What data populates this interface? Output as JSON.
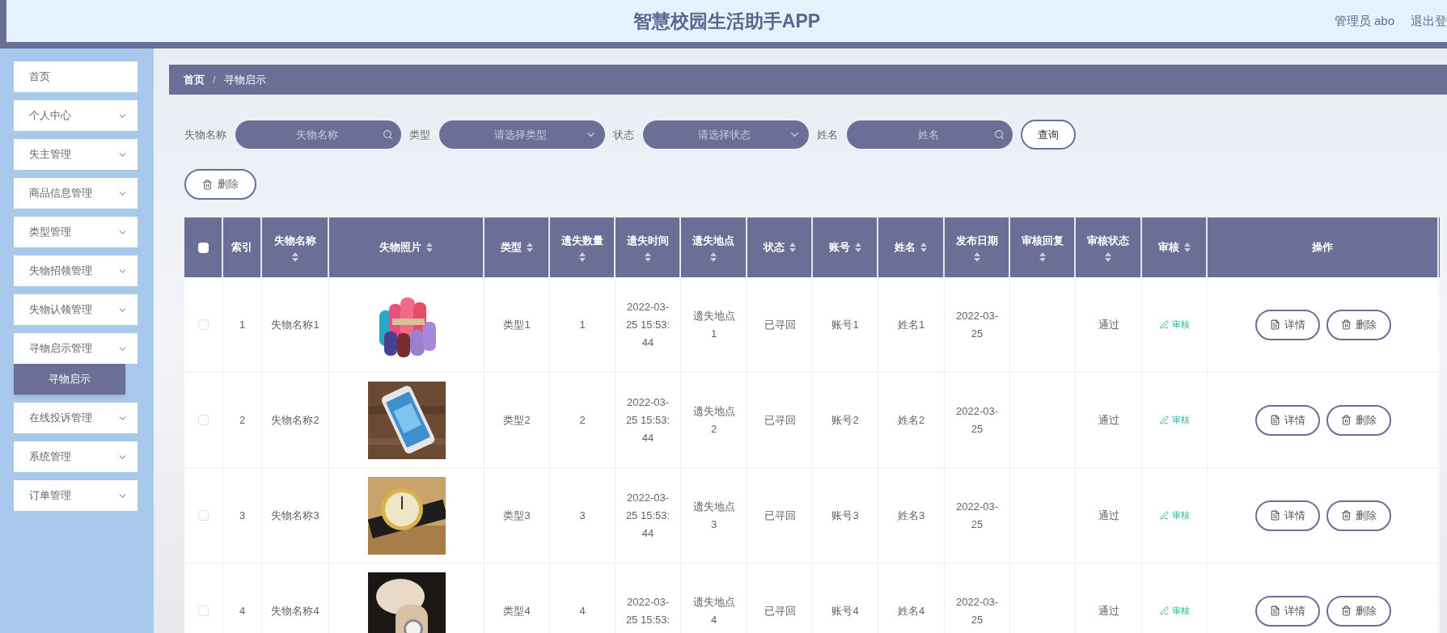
{
  "header": {
    "title": "智慧校园生活助手APP",
    "user": "管理员 abo",
    "logout": "退出登"
  },
  "sidebar": {
    "items": [
      {
        "label": "首页",
        "kind": "link"
      },
      {
        "label": "个人中心",
        "kind": "menu"
      },
      {
        "label": "失主管理",
        "kind": "menu"
      },
      {
        "label": "商品信息管理",
        "kind": "menu"
      },
      {
        "label": "类型管理",
        "kind": "menu"
      },
      {
        "label": "失物招领管理",
        "kind": "menu"
      },
      {
        "label": "失物认领管理",
        "kind": "menu"
      },
      {
        "label": "寻物启示管理",
        "kind": "menu",
        "children": [
          {
            "label": "寻物启示",
            "selected": true
          }
        ]
      },
      {
        "label": "在线投诉管理",
        "kind": "menu"
      },
      {
        "label": "系统管理",
        "kind": "menu"
      },
      {
        "label": "订单管理",
        "kind": "menu"
      }
    ]
  },
  "breadcrumb": {
    "separator": "/",
    "items": [
      "首页",
      "寻物启示"
    ]
  },
  "filters": [
    {
      "label": "失物名称",
      "kind": "input",
      "placeholder": "失物名称"
    },
    {
      "label": "类型",
      "kind": "select",
      "placeholder": "请选择类型"
    },
    {
      "label": "状态",
      "kind": "select",
      "placeholder": "请选择状态"
    },
    {
      "label": "姓名",
      "kind": "input",
      "placeholder": "姓名"
    }
  ],
  "search_button": "查询",
  "delete_button": "删除",
  "table": {
    "all_checked": false,
    "columns": [
      {
        "label": "索引",
        "sortable": false
      },
      {
        "label": "失物名称",
        "sortable": true
      },
      {
        "label": "失物照片",
        "sortable": true
      },
      {
        "label": "类型",
        "sortable": true
      },
      {
        "label": "遗失数量",
        "sortable": true
      },
      {
        "label": "遗失时间",
        "sortable": true
      },
      {
        "label": "遗失地点",
        "sortable": true
      },
      {
        "label": "状态",
        "sortable": true
      },
      {
        "label": "账号",
        "sortable": true
      },
      {
        "label": "姓名",
        "sortable": true
      },
      {
        "label": "发布日期",
        "sortable": true
      },
      {
        "label": "审核回复",
        "sortable": true
      },
      {
        "label": "审核状态",
        "sortable": true
      },
      {
        "label": "审核",
        "sortable": true
      },
      {
        "label": "操作",
        "sortable": false
      }
    ],
    "rows": [
      {
        "checked": false,
        "index": "1",
        "name": "失物名称1",
        "type": "类型1",
        "count": "1",
        "time": "2022-03-25 15:53:44",
        "place": "遗失地点1",
        "status": "已寻回",
        "account": "账号1",
        "person": "姓名1",
        "date": "2022-03-25",
        "review_status": "通过",
        "review": "审核",
        "actions": [
          "详情",
          "删除"
        ]
      },
      {
        "checked": false,
        "index": "2",
        "name": "失物名称2",
        "type": "类型2",
        "count": "2",
        "time": "2022-03-25 15:53:44",
        "place": "遗失地点2",
        "status": "已寻回",
        "account": "账号2",
        "person": "姓名2",
        "date": "2022-03-25",
        "review_status": "通过",
        "review": "审核",
        "actions": [
          "详情",
          "删除"
        ]
      },
      {
        "checked": false,
        "index": "3",
        "name": "失物名称3",
        "type": "类型3",
        "count": "3",
        "time": "2022-03-25 15:53:44",
        "place": "遗失地点3",
        "status": "已寻回",
        "account": "账号3",
        "person": "姓名3",
        "date": "2022-03-25",
        "review_status": "通过",
        "review": "审核",
        "actions": [
          "详情",
          "删除"
        ]
      },
      {
        "checked": false,
        "index": "4",
        "name": "失物名称4",
        "type": "类型4",
        "count": "4",
        "time": "2022-03-25 15:53:",
        "place": "遗失地点4",
        "status": "已寻回",
        "account": "账号4",
        "person": "姓名4",
        "date": "2022-03-25",
        "review_status": "通过",
        "review": "审核",
        "actions": [
          "详情",
          "删除"
        ]
      }
    ]
  }
}
